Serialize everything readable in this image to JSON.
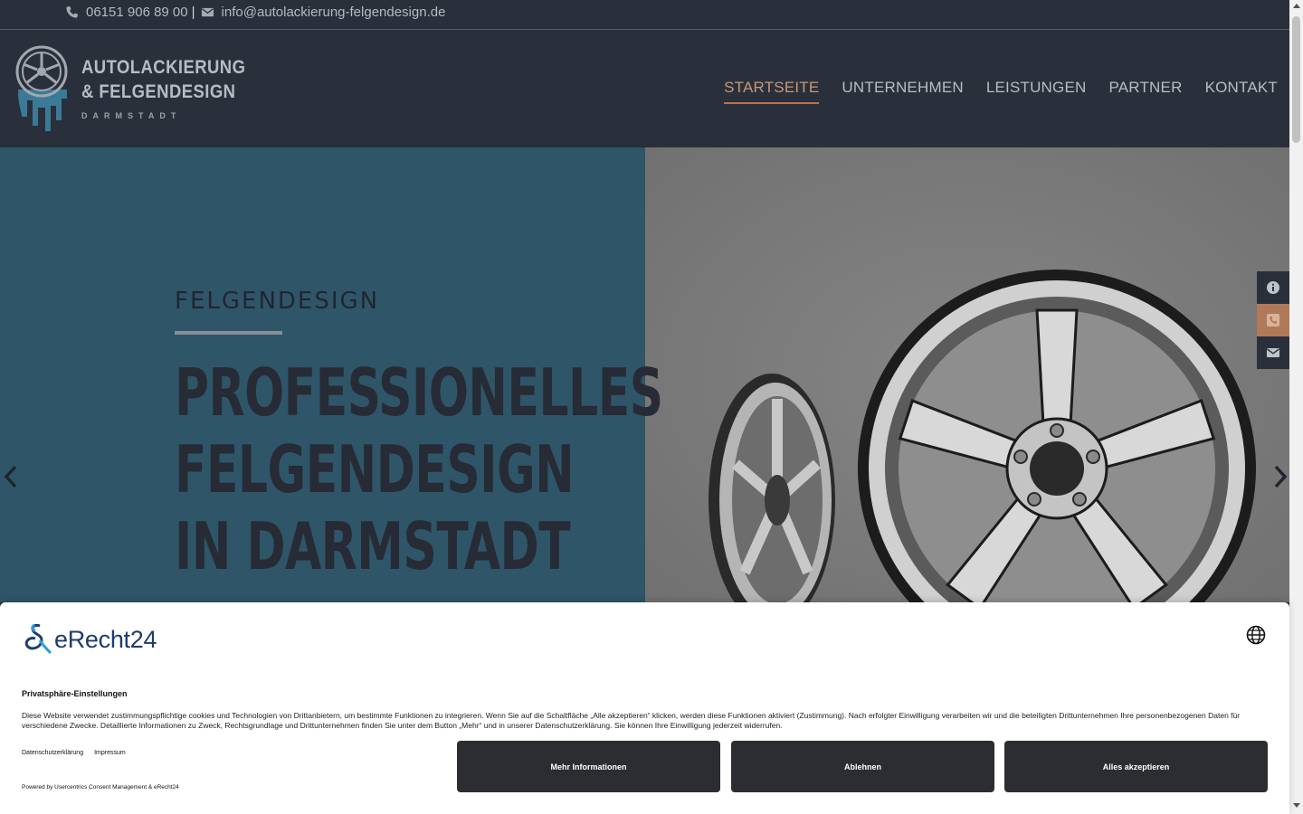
{
  "topbar": {
    "phone": "06151 906 89 00",
    "separator": "|",
    "email": "info@autolackierung-felgendesign.de"
  },
  "logo": {
    "line1": "AUTOLACKIERUNG",
    "line2": "& FELGENDESIGN",
    "sub": "DARMSTADT"
  },
  "nav": {
    "items": [
      {
        "label": "STARTSEITE",
        "active": true
      },
      {
        "label": "UNTERNEHMEN"
      },
      {
        "label": "LEISTUNGEN"
      },
      {
        "label": "PARTNER"
      },
      {
        "label": "KONTAKT"
      }
    ]
  },
  "hero": {
    "eyebrow": "FELGENDESIGN",
    "headline_lines": [
      "PROFESSIONELLES",
      "FELGENDESIGN",
      "IN DARMSTADT"
    ]
  },
  "side_buttons": [
    "info-icon",
    "phone-icon",
    "mail-icon"
  ],
  "consent": {
    "brand": "eRecht24",
    "title": "Privatsphäre-Einstellungen",
    "description": "Diese Website verwendet zustimmungspflichtige cookies und Technologien von Drittanbietern, um bestimmte Funktionen zu integrieren. Wenn Sie auf die Schaltfläche „Alle akzeptieren“ klicken, werden diese Funktionen aktiviert (Zustimmung). Nach erfolgter Einwilligung verarbeiten wir und die beteiligten Drittunternehmen Ihre personenbezogenen Daten für verschiedene Zwecke. Detaillierte Informationen zu Zweck, Rechtsgrundlage und Drittunternehmen finden Sie unter dem Button „Mehr“ und in unserer Datenschutzerklärung. Sie können Ihre Einwilligung jederzeit widerrufen.",
    "link_privacy": "Datenschutzerklärung",
    "link_imprint": "Impressum",
    "powered": "Powered by Usercentrics Consent Management & eRecht24",
    "btn_more": "Mehr Informationen",
    "btn_decline": "Ablehnen",
    "btn_accept": "Alles akzeptieren"
  },
  "colors": {
    "header_bg": "#2a303b",
    "hero_left_bg": "#2f5568",
    "accent": "#b8724d",
    "button_bg": "#2b2d30"
  }
}
